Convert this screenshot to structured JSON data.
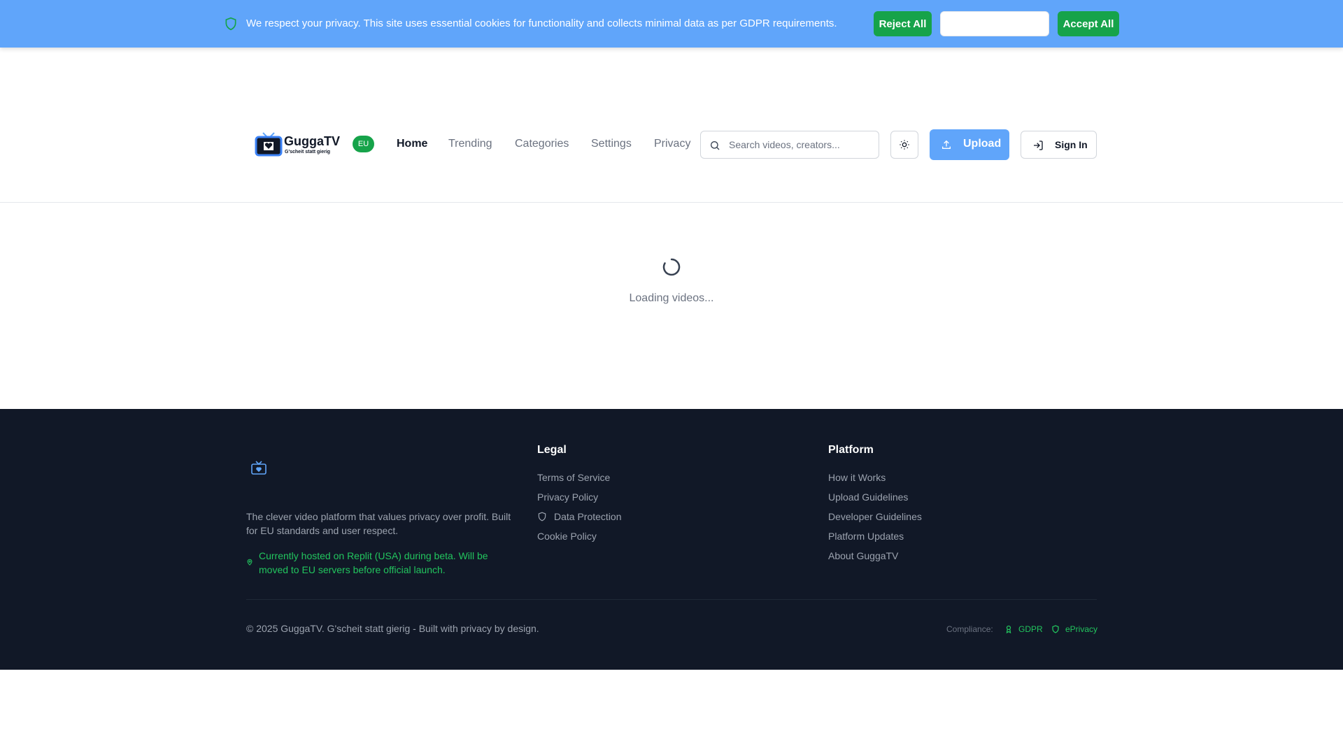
{
  "cookie_banner": {
    "text": "We respect your privacy. This site uses essential cookies for functionality and collects minimal data as per GDPR requirements.",
    "reject_label": "Reject All",
    "customize_label": "",
    "accept_label": "Accept All",
    "icon": "shield-icon"
  },
  "header": {
    "logo_name": "GuggaTV",
    "logo_tagline": "G'scheit statt gierig",
    "region_badge": "EU",
    "nav": [
      {
        "label": "Home",
        "active": true
      },
      {
        "label": "Trending",
        "active": false
      },
      {
        "label": "Categories",
        "active": false
      },
      {
        "label": "Settings",
        "active": false
      },
      {
        "label": "Privacy",
        "active": false
      }
    ],
    "search": {
      "placeholder": "Search videos, creators...",
      "value": ""
    },
    "upload_label": "Upload",
    "signin_label": "Sign In"
  },
  "main": {
    "loading_text": "Loading videos..."
  },
  "footer": {
    "description": "The clever video platform that values privacy over profit. Built for EU standards and user respect.",
    "hosting_notice": "Currently hosted on Replit (USA) during beta. Will be moved to EU servers before official launch.",
    "legal": {
      "title": "Legal",
      "links": [
        "Terms of Service",
        "Privacy Policy",
        "Data Protection",
        "Cookie Policy"
      ]
    },
    "platform": {
      "title": "Platform",
      "links": [
        "How it Works",
        "Upload Guidelines",
        "Developer Guidelines",
        "Platform Updates",
        "About GuggaTV"
      ]
    },
    "copyright": "© 2025 GuggaTV. G'scheit statt gierig - Built with privacy by design.",
    "compliance_label": "Compliance:",
    "compliance": [
      "GDPR",
      "ePrivacy"
    ]
  },
  "colors": {
    "primary_blue": "#60a5fa",
    "success_green": "#16a34a",
    "footer_bg": "#111827"
  }
}
